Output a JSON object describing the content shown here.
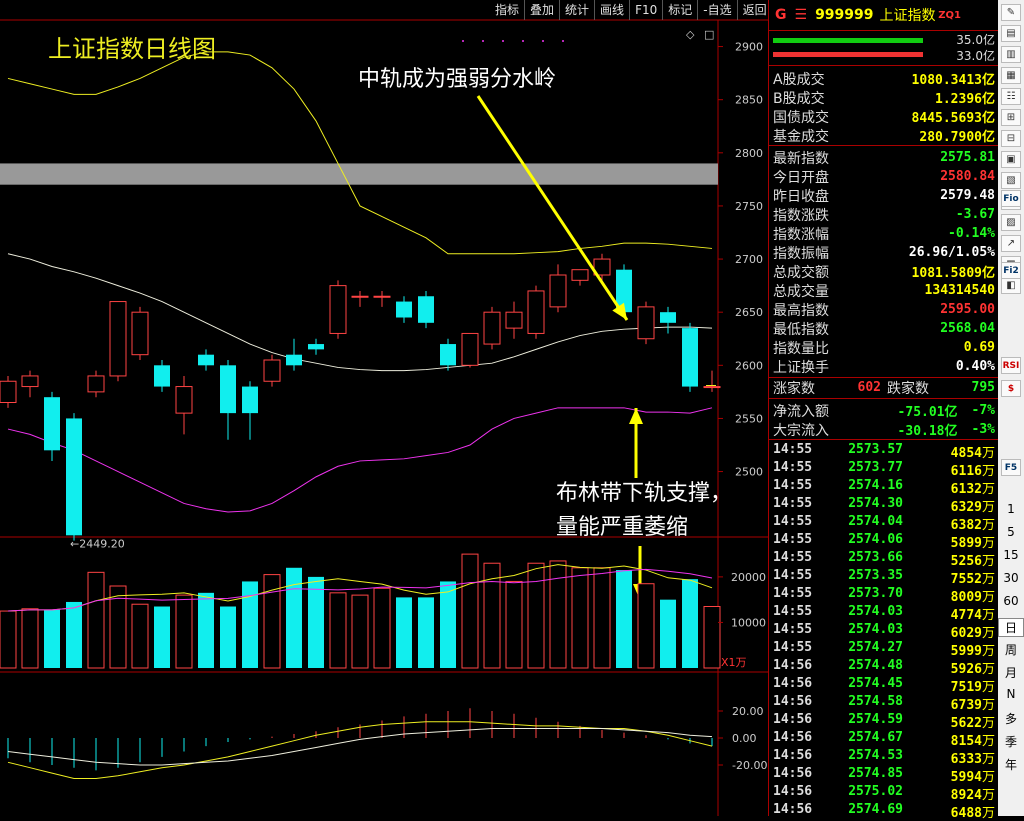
{
  "toolbar": [
    "指标",
    "叠加",
    "统计",
    "画线",
    "F10",
    "标记",
    "-自选",
    "返回"
  ],
  "chart_title": "上证指数日线图",
  "annotations": {
    "mid": "中轨成为强弱分水岭",
    "low1": "布林带下轨支撑，",
    "low2": "量能严重萎缩"
  },
  "chart_data": {
    "type": "candlestick",
    "title": "上证指数日线图",
    "price_axis": {
      "ticks": [
        2500,
        2550,
        2600,
        2650,
        2700,
        2750,
        2800,
        2850,
        2900
      ],
      "range": [
        2445,
        2925
      ]
    },
    "low_marker": "←2449.20",
    "candles": [
      [
        2565,
        2585,
        2560,
        2590
      ],
      [
        2580,
        2590,
        2570,
        2595
      ],
      [
        2570,
        2520,
        2510,
        2575
      ],
      [
        2550,
        2440,
        2435,
        2555
      ],
      [
        2575,
        2590,
        2570,
        2595
      ],
      [
        2590,
        2660,
        2585,
        2660
      ],
      [
        2610,
        2650,
        2605,
        2655
      ],
      [
        2600,
        2580,
        2575,
        2605
      ],
      [
        2555,
        2580,
        2535,
        2590
      ],
      [
        2610,
        2600,
        2595,
        2615
      ],
      [
        2600,
        2555,
        2530,
        2605
      ],
      [
        2580,
        2555,
        2530,
        2585
      ],
      [
        2585,
        2605,
        2580,
        2610
      ],
      [
        2610,
        2600,
        2595,
        2625
      ],
      [
        2620,
        2615,
        2610,
        2625
      ],
      [
        2630,
        2675,
        2625,
        2680
      ],
      [
        2665,
        2665,
        2655,
        2670
      ],
      [
        2665,
        2665,
        2655,
        2670
      ],
      [
        2660,
        2645,
        2640,
        2665
      ],
      [
        2665,
        2640,
        2635,
        2670
      ],
      [
        2620,
        2600,
        2595,
        2625
      ],
      [
        2600,
        2630,
        2598,
        2630
      ],
      [
        2620,
        2650,
        2615,
        2655
      ],
      [
        2635,
        2650,
        2625,
        2660
      ],
      [
        2630,
        2670,
        2625,
        2675
      ],
      [
        2655,
        2685,
        2650,
        2695
      ],
      [
        2680,
        2690,
        2675,
        2690
      ],
      [
        2685,
        2700,
        2680,
        2705
      ],
      [
        2690,
        2650,
        2645,
        2695
      ],
      [
        2625,
        2655,
        2620,
        2660
      ],
      [
        2650,
        2640,
        2630,
        2655
      ],
      [
        2635,
        2580,
        2575,
        2640
      ],
      [
        2580,
        2580,
        2575,
        2595
      ]
    ],
    "upper_band": [
      2870,
      2865,
      2860,
      2855,
      2855,
      2862,
      2870,
      2880,
      2890,
      2895,
      2895,
      2892,
      2880,
      2860,
      2830,
      2790,
      2750,
      2740,
      2730,
      2720,
      2705,
      2705,
      2705,
      2705,
      2706,
      2707,
      2710,
      2712,
      2715,
      2715,
      2714,
      2712,
      2710
    ],
    "mid_band": [
      2705,
      2700,
      2693,
      2688,
      2682,
      2675,
      2668,
      2660,
      2650,
      2640,
      2630,
      2620,
      2612,
      2606,
      2602,
      2598,
      2596,
      2595,
      2595,
      2596,
      2598,
      2600,
      2602,
      2608,
      2615,
      2622,
      2628,
      2632,
      2634,
      2635,
      2636,
      2636,
      2635
    ],
    "lower_band": [
      2540,
      2535,
      2527,
      2520,
      2510,
      2500,
      2490,
      2480,
      2470,
      2465,
      2462,
      2463,
      2470,
      2482,
      2495,
      2505,
      2510,
      2511,
      2512,
      2515,
      2518,
      2525,
      2540,
      2550,
      2555,
      2560,
      2560,
      2560,
      2560,
      2556,
      2556,
      2555,
      2560
    ],
    "volume": [
      12500,
      13000,
      12800,
      14500,
      21000,
      18000,
      14000,
      13500,
      16000,
      16500,
      13500,
      19000,
      20500,
      22000,
      20000,
      16500,
      16000,
      17500,
      15500,
      15500,
      19000,
      25000,
      23000,
      19000,
      23000,
      23500,
      22000,
      22000,
      21500,
      18500,
      15000,
      19500,
      13500
    ],
    "volume_axis": {
      "ticks": [
        10000,
        20000
      ],
      "unit": "X1万"
    },
    "macd_axis": {
      "ticks": [
        20.0,
        0.0,
        -20.0
      ],
      "labels": [
        "20.00",
        "0.00",
        "-20.00"
      ]
    },
    "macd_hist": [
      -15,
      -18,
      -20,
      -22,
      -24,
      -22,
      -18,
      -14,
      -10,
      -6,
      -3,
      -1,
      1,
      3,
      5,
      8,
      10,
      13,
      16,
      18,
      20,
      22,
      20,
      18,
      15,
      12,
      9,
      6,
      4,
      2,
      -1,
      -4,
      -6
    ],
    "dif": [
      -18,
      -22,
      -26,
      -30,
      -30,
      -28,
      -25,
      -22,
      -20,
      -17,
      -14,
      -10,
      -6,
      -2,
      2,
      5,
      8,
      10,
      11,
      12,
      12,
      12,
      11,
      10,
      9,
      9,
      8,
      7,
      7,
      5,
      2,
      -2,
      -6
    ],
    "dea": [
      -10,
      -12,
      -14,
      -16,
      -18,
      -19,
      -20,
      -20,
      -19,
      -18,
      -17,
      -15,
      -13,
      -10,
      -7,
      -4,
      -1,
      1,
      3,
      4,
      5,
      6,
      7,
      7,
      7,
      7,
      7,
      7,
      6,
      5,
      4,
      2,
      1
    ]
  },
  "panel": {
    "symbol_g": "G",
    "code": "999999",
    "name": "上证指数",
    "zq": "ZQ1",
    "bar_labels": [
      "35.0亿",
      "33.0亿"
    ],
    "rows1": [
      {
        "label": "A股成交",
        "value": "1080.3413亿",
        "cls": "yel"
      },
      {
        "label": "B股成交",
        "value": "1.2396亿",
        "cls": "yel"
      },
      {
        "label": "国债成交",
        "value": "8445.5693亿",
        "cls": "yel"
      },
      {
        "label": "基金成交",
        "value": "280.7900亿",
        "cls": "yel"
      }
    ],
    "rows2": [
      {
        "label": "最新指数",
        "value": "2575.81",
        "cls": "grn"
      },
      {
        "label": "今日开盘",
        "value": "2580.84",
        "cls": "red"
      },
      {
        "label": "昨日收盘",
        "value": "2579.48",
        "cls": "wht"
      },
      {
        "label": "指数涨跌",
        "value": "-3.67",
        "cls": "grn"
      },
      {
        "label": "指数涨幅",
        "value": "-0.14%",
        "cls": "grn"
      },
      {
        "label": "指数振幅",
        "value": "26.96/1.05%",
        "cls": "wht"
      },
      {
        "label": "总成交额",
        "value": "1081.5809亿",
        "cls": "yel"
      },
      {
        "label": "总成交量",
        "value": "134314540",
        "cls": "yel"
      },
      {
        "label": "最高指数",
        "value": "2595.00",
        "cls": "red"
      },
      {
        "label": "最低指数",
        "value": "2568.04",
        "cls": "grn"
      },
      {
        "label": "指数量比",
        "value": "0.69",
        "cls": "yel"
      },
      {
        "label": "上证换手",
        "value": "0.40%",
        "cls": "wht"
      }
    ],
    "updown": {
      "up_label": "涨家数",
      "up": "602",
      "down_label": "跌家数",
      "down": "795"
    },
    "flows": [
      {
        "label": "净流入额",
        "value": "-75.01亿",
        "pct": "-7%"
      },
      {
        "label": "大宗流入",
        "value": "-30.18亿",
        "pct": "-3%"
      }
    ],
    "ticks": [
      [
        "14:55",
        "2573.57",
        "4854"
      ],
      [
        "14:55",
        "2573.77",
        "6116"
      ],
      [
        "14:55",
        "2574.16",
        "6132"
      ],
      [
        "14:55",
        "2574.30",
        "6329"
      ],
      [
        "14:55",
        "2574.04",
        "6382"
      ],
      [
        "14:55",
        "2574.06",
        "5899"
      ],
      [
        "14:55",
        "2573.66",
        "5256"
      ],
      [
        "14:55",
        "2573.35",
        "7552"
      ],
      [
        "14:55",
        "2573.70",
        "8009"
      ],
      [
        "14:55",
        "2574.03",
        "4774"
      ],
      [
        "14:55",
        "2574.03",
        "6029"
      ],
      [
        "14:55",
        "2574.27",
        "5999"
      ],
      [
        "14:56",
        "2574.48",
        "5926"
      ],
      [
        "14:56",
        "2574.45",
        "7519"
      ],
      [
        "14:56",
        "2574.58",
        "6739"
      ],
      [
        "14:56",
        "2574.59",
        "5622"
      ],
      [
        "14:56",
        "2574.67",
        "8154"
      ],
      [
        "14:56",
        "2574.53",
        "6333"
      ],
      [
        "14:56",
        "2574.85",
        "5994"
      ],
      [
        "14:56",
        "2575.02",
        "8924"
      ],
      [
        "14:56",
        "2574.69",
        "6488"
      ]
    ],
    "tick_unit": "万"
  },
  "sidebar": {
    "periods": [
      "1",
      "5",
      "15",
      "30",
      "60"
    ],
    "frames": [
      "日",
      "周",
      "月",
      "N",
      "多",
      "季",
      "年"
    ],
    "active_frame": "日",
    "icons": [
      "Fio",
      "Fi2",
      "RSI",
      "$",
      "F5"
    ]
  }
}
